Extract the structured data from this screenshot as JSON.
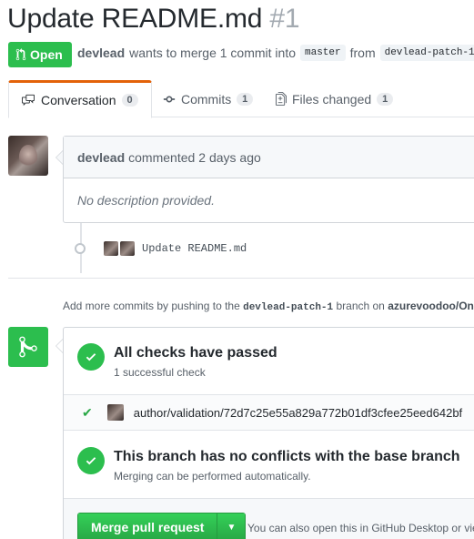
{
  "pr": {
    "title": "Update README.md",
    "number": "#1",
    "state": "Open",
    "author": "devlead",
    "meta_text": "wants to merge 1 commit into",
    "base_branch": "master",
    "from_text": "from",
    "head_branch": "devlead-patch-1"
  },
  "tabs": [
    {
      "label": "Conversation",
      "count": "0",
      "icon": "comment-discussion-icon"
    },
    {
      "label": "Commits",
      "count": "1",
      "icon": "git-commit-icon"
    },
    {
      "label": "Files changed",
      "count": "1",
      "icon": "file-diff-icon"
    }
  ],
  "comment": {
    "author": "devlead",
    "action": "commented",
    "time": "2 days ago",
    "body": "No description provided."
  },
  "commit": {
    "message": "Update README.md"
  },
  "push_hint": {
    "prefix": "Add more commits by pushing to the",
    "branch": "devlead-patch-1",
    "middle": "branch on",
    "repo": "azurevoodoo/On"
  },
  "merge": {
    "checks_title": "All checks have passed",
    "checks_sub": "1 successful check",
    "status_context": "author/validation/72d7c25e55a829a772b01df3cfee25eed642bf",
    "conflicts_title": "This branch has no conflicts with the base branch",
    "conflicts_sub": "Merging can be performed automatically.",
    "button_label": "Merge pull request",
    "alt_prefix": "You can also",
    "alt_link": "open this in GitHub Desktop",
    "alt_suffix": "or vie"
  },
  "colors": {
    "success": "#2cbe4e",
    "tab_accent": "#e36209",
    "link": "#0366d6"
  }
}
